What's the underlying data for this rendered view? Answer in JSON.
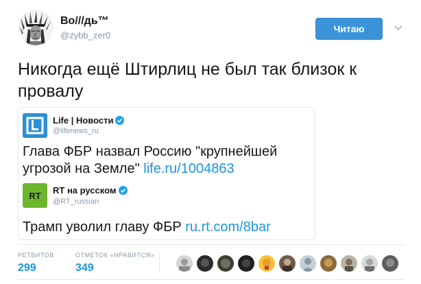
{
  "author": {
    "display_name": "Во///дь™",
    "username": "@zybb_zer0",
    "avatar_icon": "native-chief-portrait"
  },
  "follow_button": {
    "label": "Читаю",
    "color": "#3b94d9"
  },
  "tweet": {
    "text": "Никогда ещё Штирлиц не был так близок к провалу"
  },
  "quoted": [
    {
      "name": "Life | Новости",
      "handle": "@lifenews_ru",
      "avatar_icon": "life-logo",
      "verified": true,
      "text": "Глава ФБР назвал Россию \"крупнейшей угрозой на Земле\" ",
      "link": "life.ru/1004863"
    },
    {
      "name": "RT на русском",
      "handle": "@RT_russian",
      "avatar_icon": "rt-logo",
      "verified": true,
      "text": "Трамп уволил главу ФБР ",
      "link": "ru.rt.com/8bar"
    }
  ],
  "stats": {
    "retweets_label": "РЕТВИТОВ",
    "retweets": "299",
    "likes_label": "ОТМЕТОК «НРАВИТСЯ»",
    "likes": "349"
  },
  "colors": {
    "link": "#1b95e0",
    "muted": "#8899a6",
    "border": "#e1e8ed",
    "verified": "#1da1f2",
    "rt_green": "#6cb62e",
    "life_blue": "#2d8fd5"
  }
}
